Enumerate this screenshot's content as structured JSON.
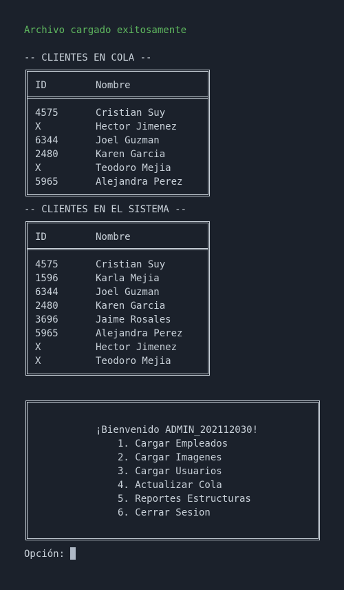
{
  "colors": {
    "background": "#1b212b",
    "text": "#c9d1d9",
    "success": "#5fb85f",
    "cursor": "#aeb8c5"
  },
  "status_message": "Archivo cargado exitosamente",
  "queue_section": {
    "title": "-- CLIENTES EN COLA --",
    "headers": {
      "id": "ID",
      "name": "Nombre"
    },
    "rows": [
      {
        "id": "4575",
        "name": "Cristian Suy"
      },
      {
        "id": "X",
        "name": "Hector Jimenez"
      },
      {
        "id": "6344",
        "name": "Joel Guzman"
      },
      {
        "id": "2480",
        "name": "Karen Garcia"
      },
      {
        "id": "X",
        "name": "Teodoro Mejia"
      },
      {
        "id": "5965",
        "name": "Alejandra Perez"
      }
    ]
  },
  "system_section": {
    "title": "-- CLIENTES EN EL SISTEMA --",
    "headers": {
      "id": "ID",
      "name": "Nombre"
    },
    "rows": [
      {
        "id": "4575",
        "name": "Cristian Suy"
      },
      {
        "id": "1596",
        "name": "Karla Mejia"
      },
      {
        "id": "6344",
        "name": "Joel Guzman"
      },
      {
        "id": "2480",
        "name": "Karen Garcia"
      },
      {
        "id": "3696",
        "name": "Jaime Rosales"
      },
      {
        "id": "5965",
        "name": "Alejandra Perez"
      },
      {
        "id": "X",
        "name": "Hector Jimenez"
      },
      {
        "id": "X",
        "name": "Teodoro Mejia"
      }
    ]
  },
  "menu": {
    "welcome": "¡Bienvenido ADMIN_202112030!",
    "options": [
      "1. Cargar Empleados",
      "2. Cargar Imagenes",
      "3. Cargar Usuarios",
      "4. Actualizar Cola",
      "5. Reportes Estructuras",
      "6. Cerrar Sesion"
    ]
  },
  "prompt": {
    "label": "Opción:"
  }
}
